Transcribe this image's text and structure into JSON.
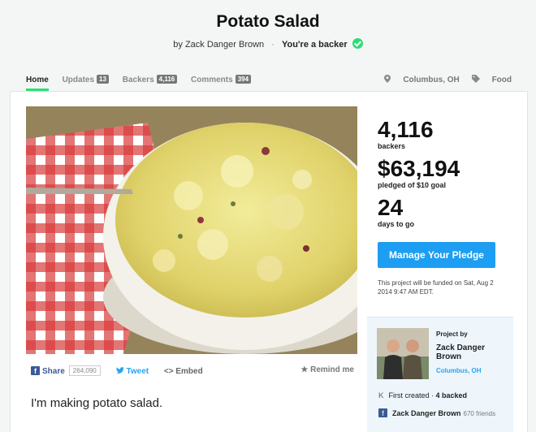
{
  "project": {
    "title": "Potato Salad",
    "byline_prefix": "by",
    "creator": "Zack Danger Brown",
    "separator": "·",
    "backer_status": "You're a backer"
  },
  "tabs": [
    {
      "label": "Home"
    },
    {
      "label": "Updates",
      "count": "13"
    },
    {
      "label": "Backers",
      "count": "4,116"
    },
    {
      "label": "Comments",
      "count": "394"
    }
  ],
  "meta": {
    "location": "Columbus, OH",
    "category": "Food",
    "location_icon": "pin-icon",
    "category_icon": "tag-icon"
  },
  "stats": {
    "backers_value": "4,116",
    "backers_label": "backers",
    "pledged_value": "$63,194",
    "pledged_label": "pledged of $10 goal",
    "days_value": "24",
    "days_label": "days to go"
  },
  "pledge_button": "Manage Your Pledge",
  "funding_note": "This project will be funded on Sat, Aug 2 2014 9:47 AM EDT.",
  "share": {
    "facebook_label": "Share",
    "facebook_count": "264,090",
    "tweet_label": "Tweet",
    "embed_label": "Embed",
    "remind_label": "Remind me"
  },
  "blurb": "I'm making potato salad.",
  "creator_box": {
    "heading": "Project by",
    "name": "Zack Danger Brown",
    "location": "Columbus, OH",
    "first_created": "First created",
    "dot": " · ",
    "backed": "4 backed",
    "fb_name": "Zack Danger Brown",
    "fb_friends": "670 friends"
  },
  "colors": {
    "accent_green": "#2bde73",
    "button_blue": "#1e9ef2",
    "facebook_blue": "#3b5998",
    "twitter_blue": "#2aa3ef"
  }
}
